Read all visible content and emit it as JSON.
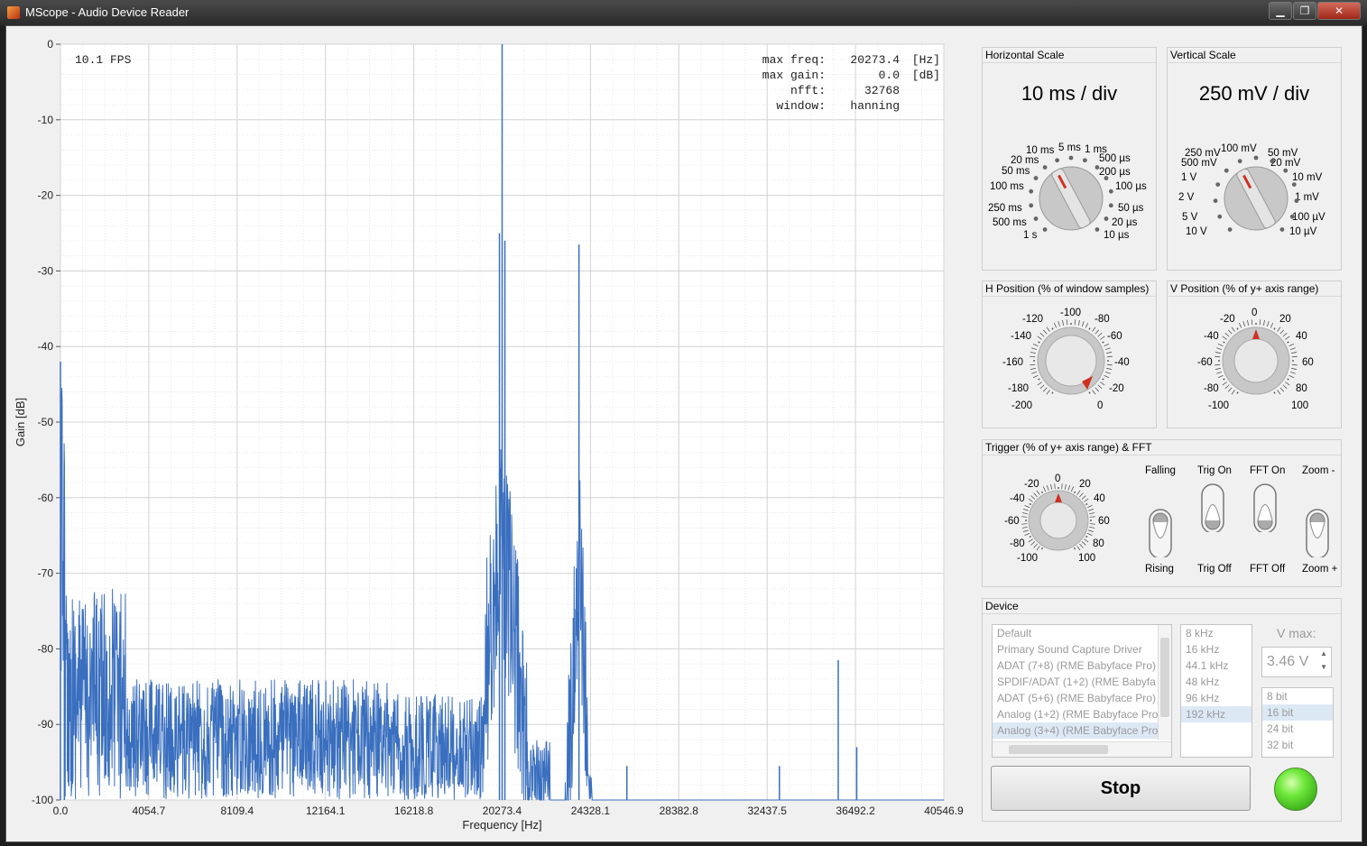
{
  "window": {
    "title": "MScope - Audio Device Reader",
    "buttons": [
      "▁",
      "❐",
      "✕"
    ]
  },
  "chart_data": {
    "type": "line",
    "xlabel": "Frequency [Hz]",
    "ylabel": "Gain [dB]",
    "xlim": [
      0,
      40546.9
    ],
    "ylim": [
      -100,
      0
    ],
    "x_ticks": [
      "0.0",
      "4054.7",
      "8109.4",
      "12164.1",
      "16218.8",
      "20273.4",
      "24328.1",
      "28382.8",
      "32437.5",
      "36492.2",
      "40546.9"
    ],
    "y_ticks": [
      "0",
      "-10",
      "-20",
      "-30",
      "-40",
      "-50",
      "-60",
      "-70",
      "-80",
      "-90",
      "-100"
    ],
    "grid": true,
    "fps_text": "10.1 FPS",
    "info": [
      {
        "label": "max freq:",
        "value": "20273.4",
        "unit": "[Hz]"
      },
      {
        "label": "max gain:",
        "value": "0.0",
        "unit": "[dB]"
      },
      {
        "label": "nfft:",
        "value": "32768",
        "unit": ""
      },
      {
        "label": "window:",
        "value": "hanning",
        "unit": ""
      }
    ],
    "series_color": "#3a6fbf",
    "peaks": [
      {
        "x": 20273.4,
        "y": 0
      },
      {
        "x": 20150,
        "y": -25
      },
      {
        "x": 20400,
        "y": -26
      },
      {
        "x": 23800,
        "y": -26.5
      },
      {
        "x": 0,
        "y": -42
      },
      {
        "x": 180,
        "y": -60
      },
      {
        "x": 26000,
        "y": -95.5
      },
      {
        "x": 33000,
        "y": -95.5
      },
      {
        "x": 35700,
        "y": -81.5
      },
      {
        "x": 36550,
        "y": -93
      }
    ],
    "noise_floor_range": [
      -100,
      -88
    ]
  },
  "horizontal_scale": {
    "title": "Horizontal Scale",
    "value": "10 ms / div",
    "labels": [
      "10 ms",
      "5 ms",
      "1 ms",
      "20 ms",
      "500 µs",
      "50 ms",
      "200 µs",
      "100 ms",
      "100 µs",
      "250 ms",
      "50 µs",
      "500 ms",
      "20 µs",
      "1 s",
      "10 µs"
    ]
  },
  "vertical_scale": {
    "title": "Vertical Scale",
    "value": "250 mV / div",
    "labels": [
      "250 mV",
      "100 mV",
      "50 mV",
      "500 mV",
      "20 mV",
      "1 V",
      "10 mV",
      "2 V",
      "1 mV",
      "5 V",
      "100 µV",
      "10 V",
      "10 µV"
    ]
  },
  "h_position": {
    "title": "H Position (% of window samples)",
    "labels": [
      "-100",
      "-120",
      "-80",
      "-140",
      "-60",
      "-160",
      "-40",
      "-180",
      "-20",
      "-200",
      "0"
    ]
  },
  "v_position": {
    "title": "V Position (% of y+ axis range)",
    "labels": [
      "0",
      "-20",
      "20",
      "-40",
      "40",
      "-60",
      "60",
      "-80",
      "80",
      "-100",
      "100"
    ]
  },
  "trigger": {
    "title": "Trigger (% of y+ axis range) & FFT",
    "labels": [
      "0",
      "-20",
      "20",
      "-40",
      "40",
      "-60",
      "60",
      "-80",
      "80",
      "-100",
      "100"
    ],
    "toggles": [
      {
        "top": "Falling",
        "bottom": "Rising"
      },
      {
        "top": "Trig On",
        "bottom": "Trig Off"
      },
      {
        "top": "FFT On",
        "bottom": "FFT Off"
      },
      {
        "top": "Zoom -",
        "bottom": "Zoom +"
      }
    ]
  },
  "device": {
    "title": "Device",
    "devices": [
      "Default",
      "Primary Sound Capture Driver",
      "ADAT (7+8) (RME Babyface Pro)",
      "SPDIF/ADAT (1+2) (RME Babyfa",
      "ADAT (5+6) (RME Babyface Pro)",
      "Analog (1+2) (RME Babyface Pro",
      "Analog (3+4) (RME Babyface Pro"
    ],
    "selected_device": 6,
    "rates": [
      "8 kHz",
      "16 kHz",
      "44.1 kHz",
      "48 kHz",
      "96 kHz",
      "192 kHz"
    ],
    "selected_rate": 5,
    "vmax_label": "V max:",
    "vmax_value": "3.46 V",
    "bits": [
      "8 bit",
      "16 bit",
      "24 bit",
      "32 bit"
    ],
    "selected_bit": 1,
    "stop_label": "Stop",
    "led_color": "#3cc81e"
  }
}
